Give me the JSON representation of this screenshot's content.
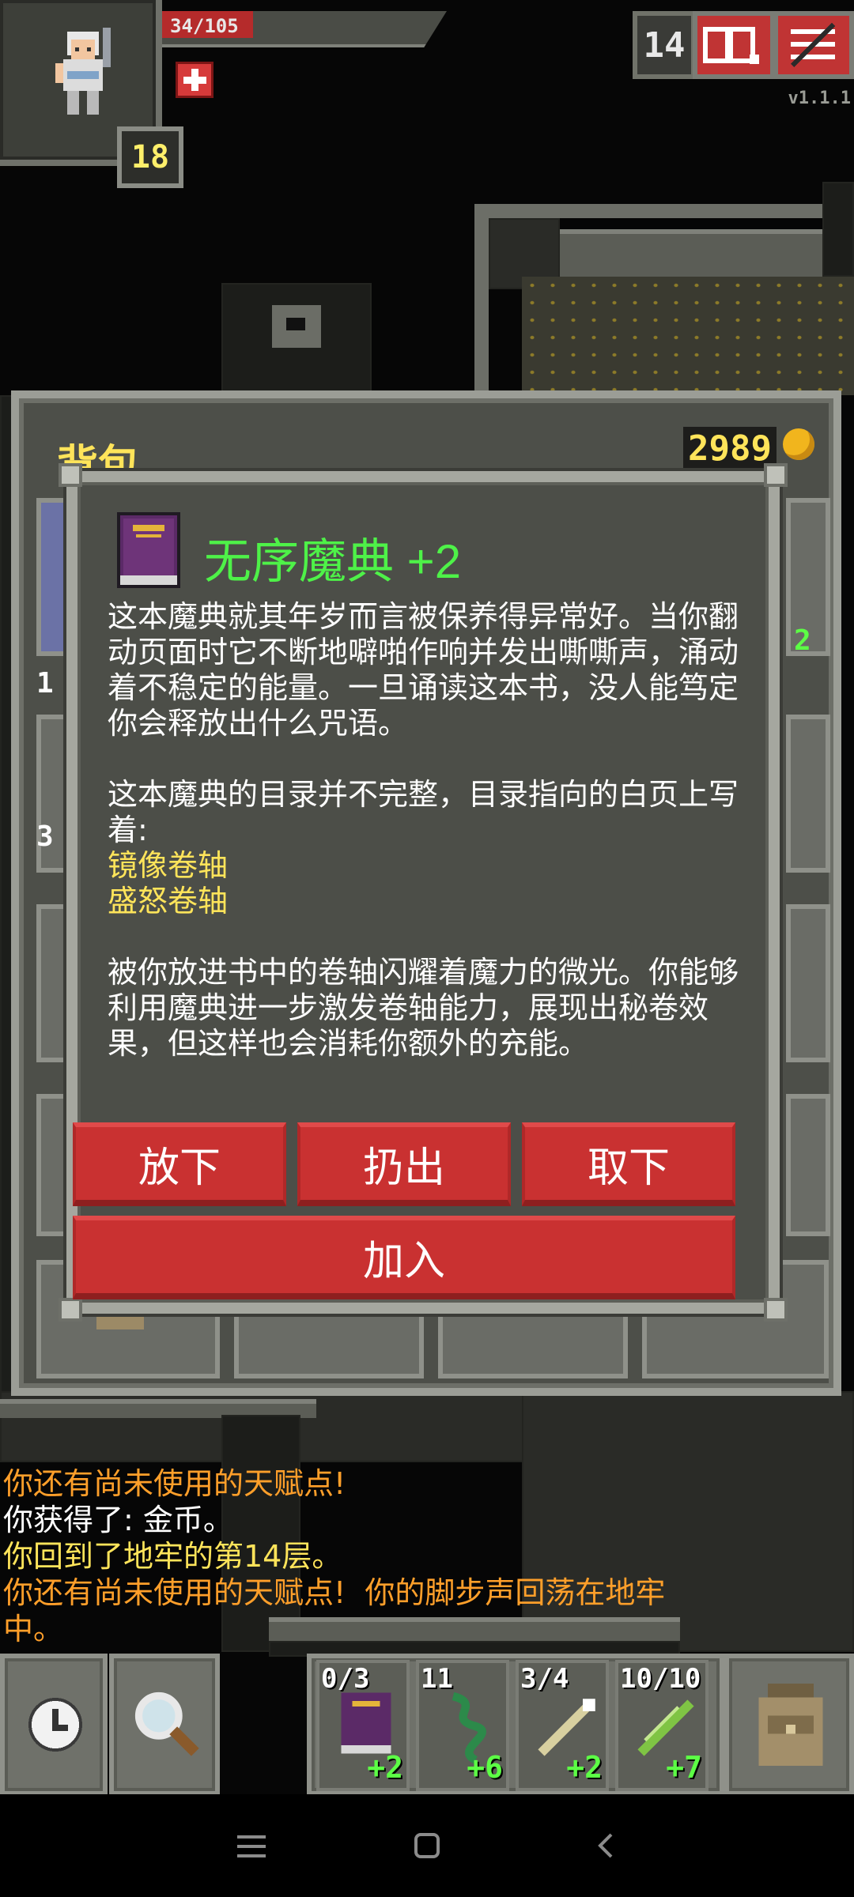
{
  "hud": {
    "hp_text": "34/105",
    "hp_fraction": 0.32,
    "hero_level": "18",
    "depth": "14",
    "version": "v1.1.1"
  },
  "backpack": {
    "title": "背包",
    "gold": "2989",
    "side_numbers": [
      "1",
      "3",
      "2"
    ],
    "right_number": "2"
  },
  "item": {
    "name": "无序魔典 +2",
    "desc_p1": "这本魔典就其年岁而言被保养得异常好。当你翻动页面时它不断地噼啪作响并发出嘶嘶声，涌动着不稳定的能量。一旦诵读这本书，没人能笃定你会释放出什么咒语。",
    "desc_p2": "这本魔典的目录并不完整，目录指向的白页上写着:",
    "scroll_1": "镜像卷轴",
    "scroll_2": "盛怒卷轴",
    "desc_p3": "被你放进书中的卷轴闪耀着魔力的微光。你能够利用魔典进一步激发卷轴能力，展现出秘卷效果，但这样也会消耗你额外的充能。",
    "buttons": {
      "drop": "放下",
      "throw": "扔出",
      "unequip": "取下",
      "add": "加入"
    }
  },
  "log": [
    {
      "text": "你还有尚未使用的天赋点!",
      "color": "#ff9f2a"
    },
    {
      "text": "你获得了: 金币。",
      "color": "#ffffff"
    },
    {
      "text": "你回到了地牢的第14层。",
      "color": "#ffe45a"
    },
    {
      "text": "你还有尚未使用的天赋点!  你的脚步声回荡在地牢中。",
      "color": "#ff9f2a"
    }
  ],
  "quickslots": [
    {
      "top": "0/3",
      "bottom": "+2",
      "icon": "grimoire-icon"
    },
    {
      "top": "11",
      "bottom": "+6",
      "icon": "vine-whip-icon"
    },
    {
      "top": "3/4",
      "bottom": "+2",
      "icon": "wand-icon"
    },
    {
      "top": "10/10",
      "bottom": "+7",
      "icon": "green-wand-icon"
    }
  ],
  "colors": {
    "accent_green": "#4ef248",
    "gold": "#ffe45a",
    "button_red": "#c93131",
    "warning_orange": "#ff9f2a"
  }
}
